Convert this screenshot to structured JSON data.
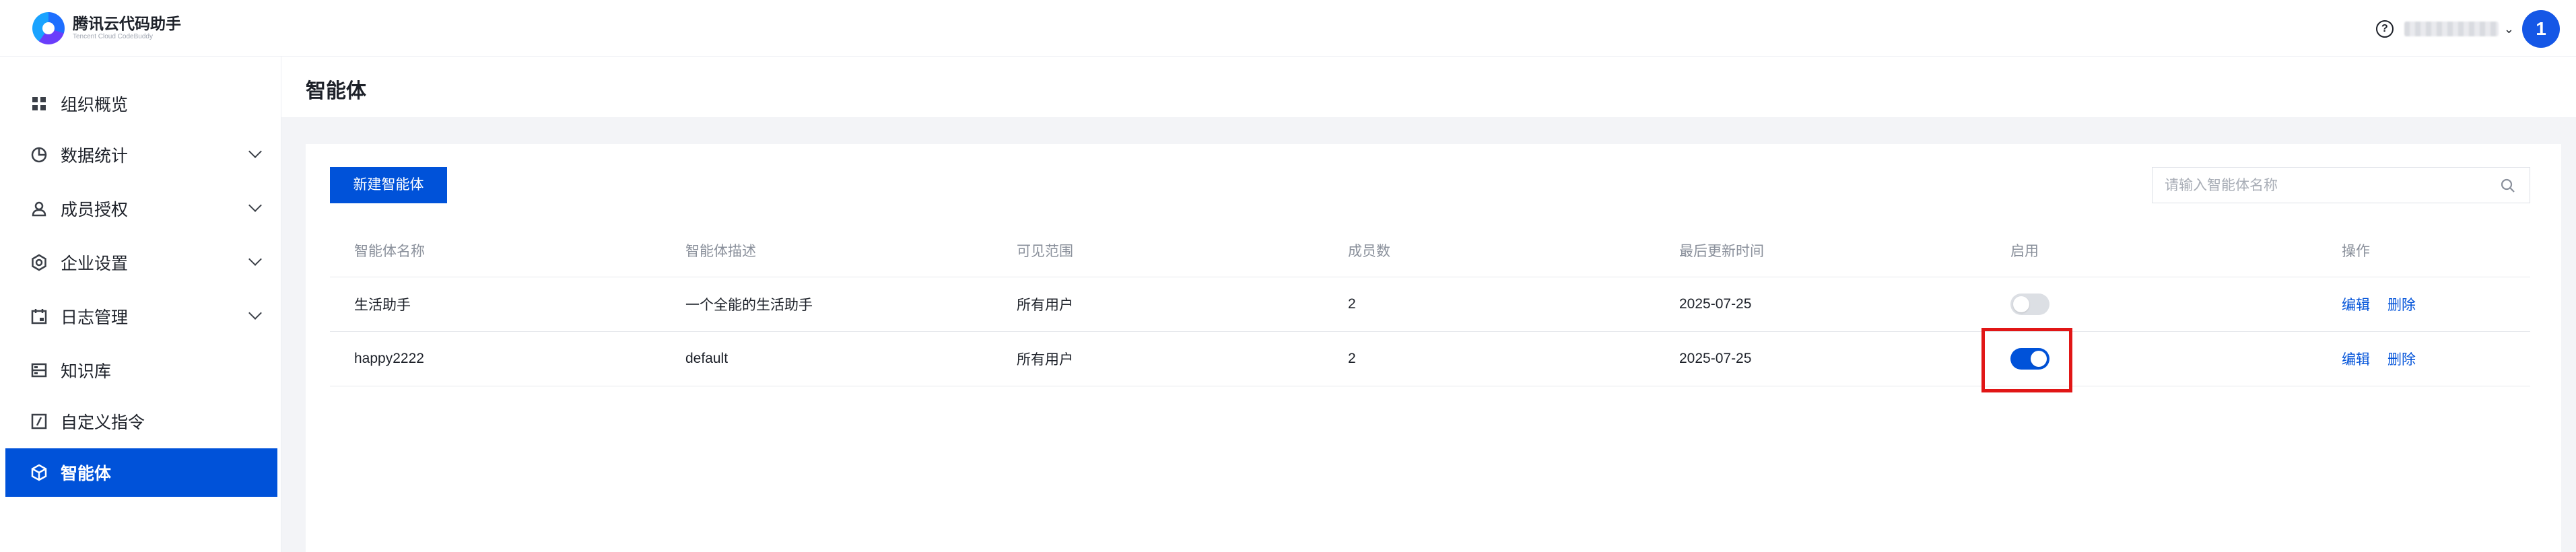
{
  "brand": {
    "name": "腾讯云代码助手",
    "subtitle": "Tencent Cloud CodeBuddy"
  },
  "header": {
    "help_icon": "question-circle-icon",
    "avatar_label": "1"
  },
  "sidebar": {
    "items": [
      {
        "label": "组织概览",
        "icon": "grid-icon",
        "expandable": false,
        "active": false
      },
      {
        "label": "数据统计",
        "icon": "pie-chart-icon",
        "expandable": true,
        "active": false
      },
      {
        "label": "成员授权",
        "icon": "user-icon",
        "expandable": true,
        "active": false
      },
      {
        "label": "企业设置",
        "icon": "settings-icon",
        "expandable": true,
        "active": false
      },
      {
        "label": "日志管理",
        "icon": "calendar-icon",
        "expandable": true,
        "active": false
      },
      {
        "label": "知识库",
        "icon": "database-icon",
        "expandable": false,
        "active": false
      },
      {
        "label": "自定义指令",
        "icon": "command-icon",
        "expandable": false,
        "active": false
      },
      {
        "label": "智能体",
        "icon": "cube-icon",
        "expandable": false,
        "active": true
      }
    ]
  },
  "page": {
    "title": "智能体"
  },
  "toolbar": {
    "new_label": "新建智能体",
    "search_placeholder": "请输入智能体名称",
    "search_value": ""
  },
  "table": {
    "columns": [
      "智能体名称",
      "智能体描述",
      "可见范围",
      "成员数",
      "最后更新时间",
      "启用",
      "操作"
    ],
    "rows": [
      {
        "name": "生活助手",
        "desc": "一个全能的生活助手",
        "scope": "所有用户",
        "members": "2",
        "updated": "2025-07-25",
        "enabled": false,
        "edit": "编辑",
        "delete": "删除"
      },
      {
        "name": "happy2222",
        "desc": "default",
        "scope": "所有用户",
        "members": "2",
        "updated": "2025-07-25",
        "enabled": true,
        "edit": "编辑",
        "delete": "删除"
      }
    ]
  },
  "colors": {
    "primary": "#0052d9",
    "highlight": "#e11616",
    "toggle_off": "#dcdfe4"
  }
}
